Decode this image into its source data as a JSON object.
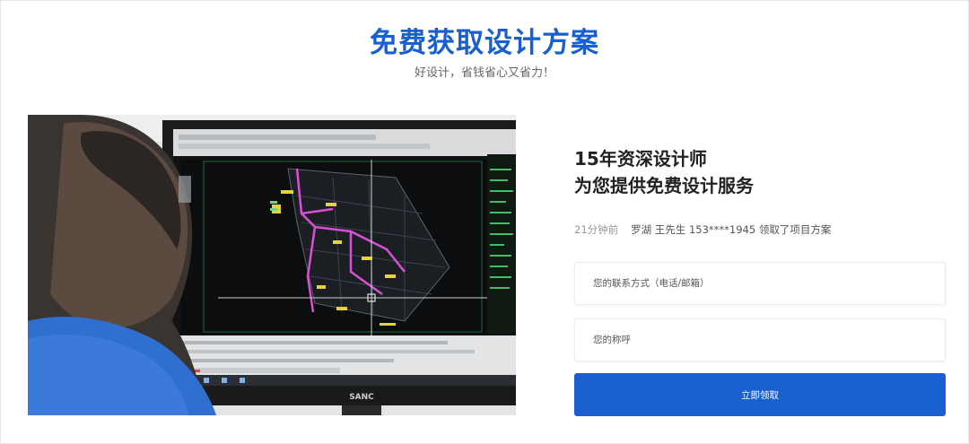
{
  "header": {
    "title": "免费获取设计方案",
    "subtitle": "好设计，省钱省心又省力！"
  },
  "photo": {
    "monitor_brand": "SANC"
  },
  "panel": {
    "title_line1": "15年资深设计师",
    "title_line2": "为您提供免费设计服务",
    "activity_time": "21分钟前",
    "activity_text": "罗湖 王先生 153****1945 领取了项目方案"
  },
  "form": {
    "contact_placeholder": "您的联系方式（电话/邮箱）",
    "name_placeholder": "您的称呼",
    "submit_label": "立即领取"
  },
  "colors": {
    "accent": "#1a5fd0",
    "title_text": "#222222",
    "muted_text": "#999999"
  }
}
